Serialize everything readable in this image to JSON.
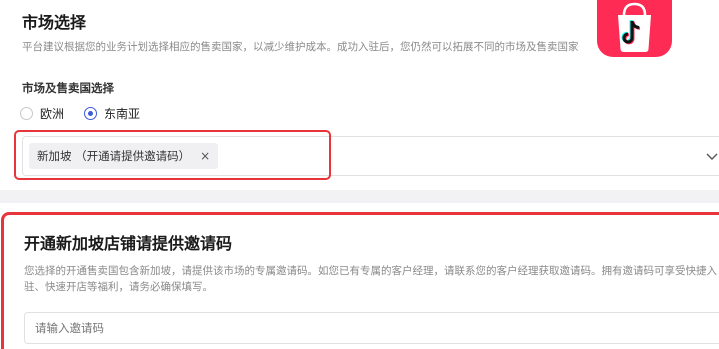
{
  "market": {
    "title": "市场选择",
    "description": "平台建议根据您的业务计划选择相应的售卖国家，以减少维护成本。成功入驻后，您仍然可以拓展不同的市场及售卖国家",
    "field_label": "市场及售卖国选择",
    "radio_options": [
      {
        "label": "欧洲",
        "checked": false
      },
      {
        "label": "东南亚",
        "checked": true
      }
    ],
    "selected_tag": "新加坡 （开通请提供邀请码）",
    "tag_close": "×"
  },
  "invite": {
    "title": "开通新加坡店铺请提供邀请码",
    "description": "您选择的开通售卖国包含新加坡，请提供该市场的专属邀请码。如您已有专属的客户经理，请联系您的客户经理获取邀请码。拥有邀请码可享受快捷入驻、快速开店等福利，请务必确保填写。",
    "input_placeholder": "请输入邀请码"
  },
  "colors": {
    "highlight": "#e8353b",
    "accent": "#3b5bdb",
    "badge": "#fe2c55"
  },
  "icons": {
    "badge": "tiktok-shop-icon",
    "dropdown": "chevron-down-icon"
  }
}
